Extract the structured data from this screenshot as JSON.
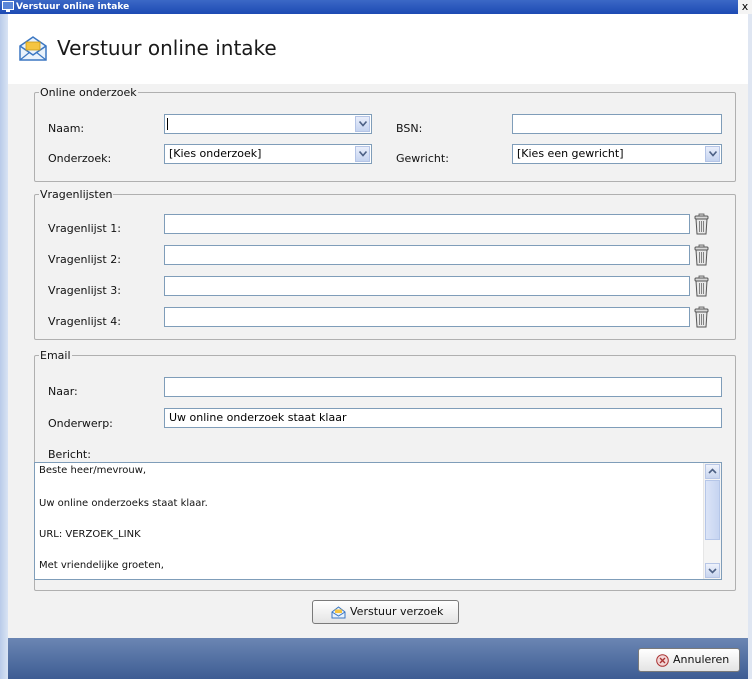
{
  "window": {
    "title": "Verstuur online intake",
    "close_glyph": "x"
  },
  "header": {
    "title": "Verstuur online intake",
    "icon": "envelope-icon"
  },
  "online_onderzoek": {
    "legend": "Online onderzoek",
    "naam": {
      "label": "Naam:",
      "value": ""
    },
    "bsn": {
      "label": "BSN:",
      "value": ""
    },
    "onderzoek": {
      "label": "Onderzoek:",
      "value": "[Kies onderzoek]"
    },
    "gewricht": {
      "label": "Gewricht:",
      "value": "[Kies een gewricht]"
    }
  },
  "vragenlijsten": {
    "legend": "Vragenlijsten",
    "items": [
      {
        "label": "Vragenlijst 1:",
        "value": ""
      },
      {
        "label": "Vragenlijst 2:",
        "value": ""
      },
      {
        "label": "Vragenlijst 3:",
        "value": ""
      },
      {
        "label": "Vragenlijst 4:",
        "value": ""
      }
    ]
  },
  "email": {
    "legend": "Email",
    "naar": {
      "label": "Naar:",
      "value": ""
    },
    "onderwerp": {
      "label": "Onderwerp:",
      "value": "Uw online onderzoek staat klaar"
    },
    "bericht": {
      "label": "Bericht:",
      "lines": [
        "Beste heer/mevrouw,",
        "Uw online onderzoeks staat klaar.",
        "URL: VERZOEK_LINK",
        "Met vriendelijke groeten,"
      ]
    }
  },
  "actions": {
    "send_label": "Verstuur verzoek",
    "cancel_label": "Annuleren"
  },
  "colors": {
    "titlebar": "#1d4ab3",
    "footer": "#3d5c93",
    "panel": "#f2f2f2"
  }
}
